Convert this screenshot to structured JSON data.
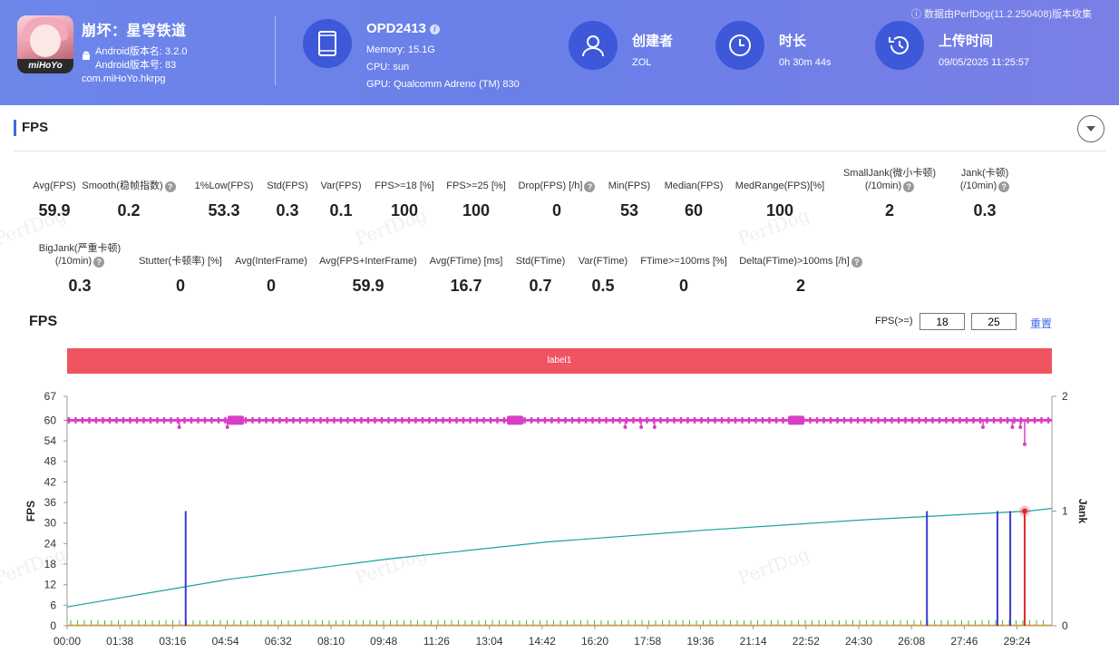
{
  "header": {
    "app_name": "崩坏：星穹铁道",
    "app_icon_brand": "miHoYo",
    "version_name": "Android版本名: 3.2.0",
    "version_code": "Android版本号: 83",
    "package": "com.miHoYo.hkrpg",
    "device": {
      "name": "OPD2413",
      "memory": "Memory: 15.1G",
      "cpu": "CPU: sun",
      "gpu": "GPU: Qualcomm Adreno (TM) 830"
    },
    "creator_label": "创建者",
    "creator_value": "ZOL",
    "duration_label": "时长",
    "duration_value": "0h 30m 44s",
    "upload_label": "上传时间",
    "upload_value": "09/05/2025 11:25:57",
    "collect_note": "ⓘ 数据由PerfDog(11.2.250408)版本收集"
  },
  "section": {
    "title": "FPS"
  },
  "metrics_row1": [
    {
      "label": "Avg(FPS)",
      "value": "59.9"
    },
    {
      "label": "Smooth(稳帧指数)",
      "value": "0.2",
      "help": true
    },
    {
      "label": "1%Low(FPS)",
      "value": "53.3"
    },
    {
      "label": "Std(FPS)",
      "value": "0.3"
    },
    {
      "label": "Var(FPS)",
      "value": "0.1"
    },
    {
      "label": "FPS>=18 [%]",
      "value": "100"
    },
    {
      "label": "FPS>=25 [%]",
      "value": "100"
    },
    {
      "label": "Drop(FPS) [/h]",
      "value": "0",
      "help": true
    },
    {
      "label": "Min(FPS)",
      "value": "53"
    },
    {
      "label": "Median(FPS)",
      "value": "60"
    },
    {
      "label": "MedRange(FPS)[%]",
      "value": "100"
    },
    {
      "label": "SmallJank(微小卡顿)",
      "label2": "(/10min)",
      "value": "2",
      "help": true
    },
    {
      "label": "Jank(卡顿)",
      "label2": "(/10min)",
      "value": "0.3",
      "help": true
    }
  ],
  "metrics_row2": [
    {
      "label": "BigJank(严重卡顿)",
      "label2": "(/10min)",
      "value": "0.3",
      "help": true
    },
    {
      "label": "Stutter(卡顿率) [%]",
      "value": "0"
    },
    {
      "label": "Avg(InterFrame)",
      "value": "0"
    },
    {
      "label": "Avg(FPS+InterFrame)",
      "value": "59.9"
    },
    {
      "label": "Avg(FTime) [ms]",
      "value": "16.7"
    },
    {
      "label": "Std(FTime)",
      "value": "0.7"
    },
    {
      "label": "Var(FTime)",
      "value": "0.5"
    },
    {
      "label": "FTime>=100ms [%]",
      "value": "0"
    },
    {
      "label": "Delta(FTime)>100ms [/h]",
      "value": "2",
      "help": true
    }
  ],
  "watermark": "PerfDog",
  "chart_controls": {
    "title": "FPS",
    "threshold_label": "FPS(>=)",
    "threshold1": "18",
    "threshold2": "25",
    "reset_label": "重置",
    "band_label": "label1"
  },
  "colors": {
    "header_bg": "#6a7fe8",
    "icon_circle": "#3d58d9",
    "fps_line": "#d93fc4",
    "jank_bar": "#3b3bd6",
    "bigjank_bar": "#e0292f",
    "trend_line": "#1aa39a",
    "stutter_ticks": "#3fb63f",
    "band": "#ef5461"
  },
  "chart_data": {
    "type": "line",
    "title": "FPS",
    "ylabel": "FPS",
    "y2label": "Jank",
    "ylim": [
      0,
      67
    ],
    "y2lim": [
      0,
      2
    ],
    "yticks": [
      0,
      6,
      12,
      18,
      24,
      30,
      36,
      42,
      48,
      54,
      60,
      67
    ],
    "y2ticks": [
      0,
      1,
      2
    ],
    "xticks": [
      "00:00",
      "01:38",
      "03:16",
      "04:54",
      "06:32",
      "08:10",
      "09:48",
      "11:26",
      "13:04",
      "14:42",
      "16:20",
      "17:58",
      "19:36",
      "21:14",
      "22:52",
      "24:30",
      "26:08",
      "27:46",
      "29:24"
    ],
    "xrange_seconds": [
      0,
      1844
    ],
    "fps_baseline": 60,
    "fps_dips": [
      {
        "t": 210,
        "fps": 58
      },
      {
        "t": 300,
        "fps": 58
      },
      {
        "t": 1045,
        "fps": 58
      },
      {
        "t": 1075,
        "fps": 58
      },
      {
        "t": 1100,
        "fps": 58
      },
      {
        "t": 1715,
        "fps": 58
      },
      {
        "t": 1770,
        "fps": 58
      },
      {
        "t": 1785,
        "fps": 58
      },
      {
        "t": 1793,
        "fps": 53
      }
    ],
    "jank_events": [
      {
        "t": 222,
        "value": 1,
        "type": "jank"
      },
      {
        "t": 1610,
        "value": 1,
        "type": "jank"
      },
      {
        "t": 1742,
        "value": 1,
        "type": "jank"
      },
      {
        "t": 1766,
        "value": 1,
        "type": "jank"
      },
      {
        "t": 1793,
        "value": 1,
        "type": "bigjank"
      }
    ],
    "trend": {
      "x": [
        0,
        300,
        600,
        900,
        1200,
        1500,
        1800,
        1844
      ],
      "y": [
        5.5,
        13.5,
        19.5,
        24.5,
        28.0,
        31.0,
        33.5,
        34.3
      ]
    }
  }
}
